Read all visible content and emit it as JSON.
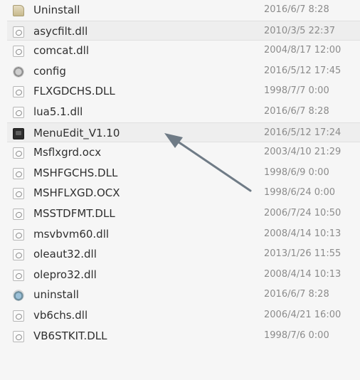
{
  "files": [
    {
      "name": "Uninstall",
      "date": "2016/6/7 8:28",
      "icon": "folder-icon"
    },
    {
      "name": "asycfilt.dll",
      "date": "2010/3/5 22:37",
      "icon": "dll-file-icon"
    },
    {
      "name": "comcat.dll",
      "date": "2004/8/17 12:00",
      "icon": "dll-file-icon"
    },
    {
      "name": "config",
      "date": "2016/5/12 17:45",
      "icon": "config-file-icon"
    },
    {
      "name": "FLXGDCHS.DLL",
      "date": "1998/7/7 0:00",
      "icon": "dll-file-icon"
    },
    {
      "name": "lua5.1.dll",
      "date": "2016/6/7 8:28",
      "icon": "dll-file-icon"
    },
    {
      "name": "MenuEdit_V1.10",
      "date": "2016/5/12 17:24",
      "icon": "application-icon"
    },
    {
      "name": "Msflxgrd.ocx",
      "date": "2003/4/10 21:29",
      "icon": "dll-file-icon"
    },
    {
      "name": "MSHFGCHS.DLL",
      "date": "1998/6/9 0:00",
      "icon": "dll-file-icon"
    },
    {
      "name": "MSHFLXGD.OCX",
      "date": "1998/6/24 0:00",
      "icon": "dll-file-icon"
    },
    {
      "name": "MSSTDFMT.DLL",
      "date": "2006/7/24 10:50",
      "icon": "dll-file-icon"
    },
    {
      "name": "msvbvm60.dll",
      "date": "2008/4/14 10:13",
      "icon": "dll-file-icon"
    },
    {
      "name": "oleaut32.dll",
      "date": "2013/1/26 11:55",
      "icon": "dll-file-icon"
    },
    {
      "name": "olepro32.dll",
      "date": "2008/4/14 10:13",
      "icon": "dll-file-icon"
    },
    {
      "name": "uninstall",
      "date": "2016/6/7 8:28",
      "icon": "installer-icon"
    },
    {
      "name": "vb6chs.dll",
      "date": "2006/4/21 16:00",
      "icon": "dll-file-icon"
    },
    {
      "name": "VB6STKIT.DLL",
      "date": "1998/7/6 0:00",
      "icon": "dll-file-icon"
    }
  ],
  "colors": {
    "background": "#f6f6f6",
    "name_text": "#2f2f2f",
    "date_text": "#8b8b8b",
    "arrow": "#6f7b86"
  }
}
